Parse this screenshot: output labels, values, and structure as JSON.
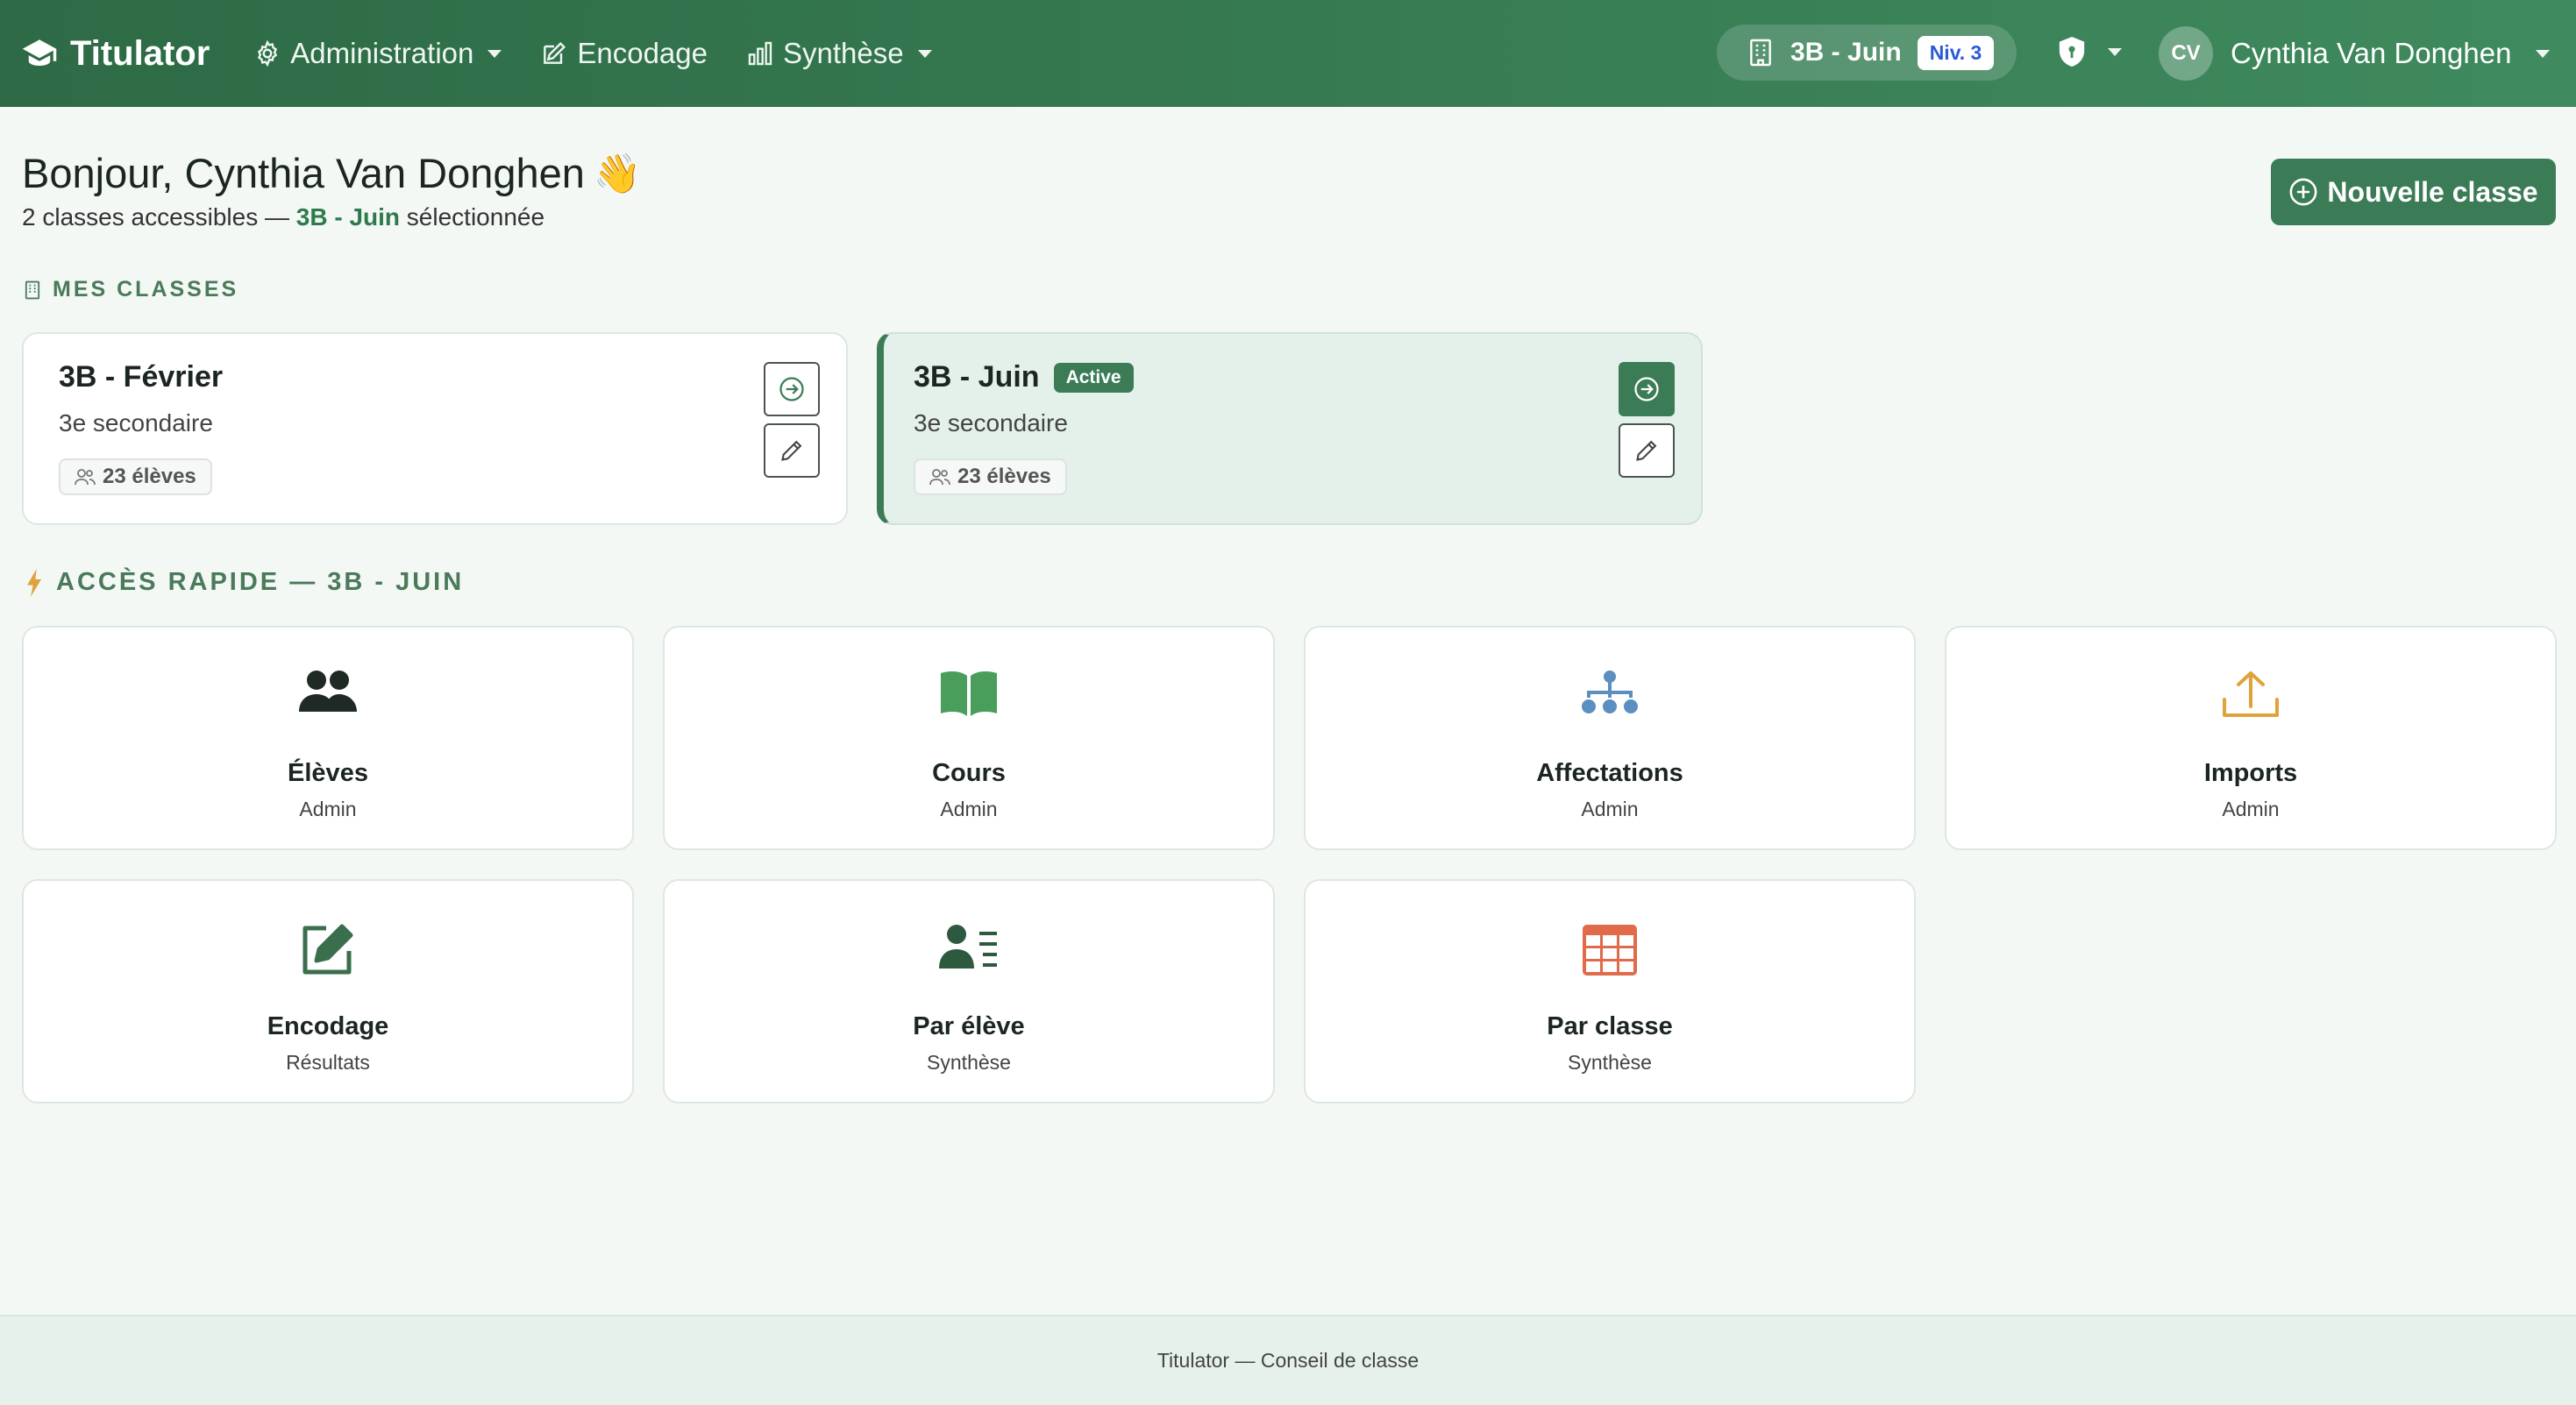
{
  "navbar": {
    "brand": "Titulator",
    "menu": [
      {
        "label": "Administration",
        "icon": "gear-icon",
        "dropdown": true
      },
      {
        "label": "Encodage",
        "icon": "edit-icon",
        "dropdown": false
      },
      {
        "label": "Synthèse",
        "icon": "bar-chart-icon",
        "dropdown": true
      }
    ],
    "current_class": "3B - Juin",
    "level_badge": "Niv. 3",
    "user_initials": "CV",
    "user_name": "Cynthia Van Donghen"
  },
  "header": {
    "greeting": "Bonjour, Cynthia Van Donghen",
    "wave": "👋",
    "subtitle_prefix": "2 classes accessibles — ",
    "subtitle_selected": "3B - Juin",
    "subtitle_suffix": " sélectionnée",
    "new_class_button": "Nouvelle classe"
  },
  "my_classes": {
    "label": "MES CLASSES",
    "items": [
      {
        "name": "3B - Février",
        "level": "3e secondaire",
        "students": "23 élèves",
        "active": false
      },
      {
        "name": "3B - Juin",
        "level": "3e secondaire",
        "students": "23 élèves",
        "active": true,
        "active_label": "Active"
      }
    ]
  },
  "quick_access": {
    "label": "ACCÈS RAPIDE — 3B - JUIN",
    "tiles": [
      {
        "label": "Élèves",
        "sub": "Admin",
        "icon": "users-icon",
        "color": "#1f2a24"
      },
      {
        "label": "Cours",
        "sub": "Admin",
        "icon": "book-icon",
        "color": "#4a9e5c"
      },
      {
        "label": "Affectations",
        "sub": "Admin",
        "icon": "sitemap-icon",
        "color": "#5a8fc0"
      },
      {
        "label": "Imports",
        "sub": "Admin",
        "icon": "upload-icon",
        "color": "#e0a23a"
      },
      {
        "label": "Encodage",
        "sub": "Résultats",
        "icon": "edit-icon",
        "color": "#3b6e4c"
      },
      {
        "label": "Par élève",
        "sub": "Synthèse",
        "icon": "user-list-icon",
        "color": "#2d5a3e"
      },
      {
        "label": "Par classe",
        "sub": "Synthèse",
        "icon": "table-icon",
        "color": "#e06a4a"
      }
    ]
  },
  "footer": {
    "text": "Titulator — Conseil de classe"
  }
}
